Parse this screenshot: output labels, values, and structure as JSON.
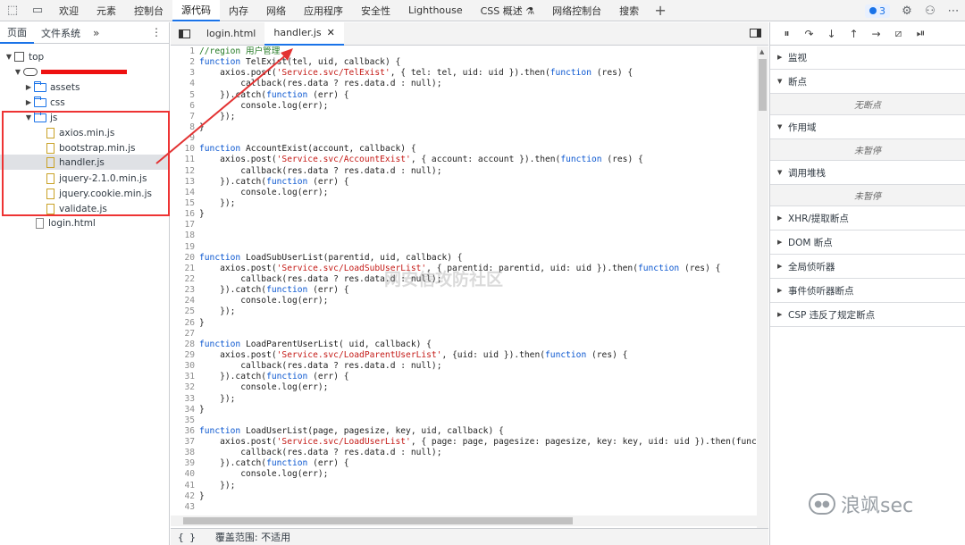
{
  "topbar": {
    "tabs": [
      "欢迎",
      "元素",
      "控制台",
      "源代码",
      "内存",
      "网络",
      "应用程序",
      "安全性",
      "Lighthouse",
      "CSS 概述 ⚗",
      "网络控制台",
      "搜索"
    ],
    "active_tab": "源代码",
    "badge_count": "3",
    "icons": [
      "inspect-icon",
      "device-icon",
      "plus-icon",
      "gear-icon",
      "connect-icon",
      "more-icon"
    ]
  },
  "navigator": {
    "tabs": [
      "页面",
      "文件系统"
    ],
    "tree": {
      "top": "top",
      "folders": [
        "assets",
        "css",
        "js"
      ],
      "js_files": [
        "axios.min.js",
        "bootstrap.min.js",
        "handler.js",
        "jquery-2.1.0.min.js",
        "jquery.cookie.min.js",
        "validate.js"
      ],
      "root_file": "login.html",
      "selected": "handler.js"
    }
  },
  "editor": {
    "tabs": [
      "login.html",
      "handler.js"
    ],
    "active_tab": "handler.js",
    "lines": [
      "//region 用户管理",
      "function TelExist(tel, uid, callback) {",
      "    axios.post('Service.svc/TelExist', { tel: tel, uid: uid }).then(function (res) {",
      "        callback(res.data ? res.data.d : null);",
      "    }).catch(function (err) {",
      "        console.log(err);",
      "    });",
      "}",
      "",
      "function AccountExist(account, callback) {",
      "    axios.post('Service.svc/AccountExist', { account: account }).then(function (res) {",
      "        callback(res.data ? res.data.d : null);",
      "    }).catch(function (err) {",
      "        console.log(err);",
      "    });",
      "}",
      "",
      "",
      "",
      "function LoadSubUserList(parentid, uid, callback) {",
      "    axios.post('Service.svc/LoadSubUserList', { parentid: parentid, uid: uid }).then(function (res) {",
      "        callback(res.data ? res.data.d : null);",
      "    }).catch(function (err) {",
      "        console.log(err);",
      "    });",
      "}",
      "",
      "function LoadParentUserList( uid, callback) {",
      "    axios.post('Service.svc/LoadParentUserList', {uid: uid }).then(function (res) {",
      "        callback(res.data ? res.data.d : null);",
      "    }).catch(function (err) {",
      "        console.log(err);",
      "    });",
      "}",
      "",
      "function LoadUserList(page, pagesize, key, uid, callback) {",
      "    axios.post('Service.svc/LoadUserList', { page: page, pagesize: pagesize, key: key, uid: uid }).then(functio",
      "        callback(res.data ? res.data.d : null);",
      "    }).catch(function (err) {",
      "        console.log(err);",
      "    });",
      "}",
      ""
    ],
    "status_brackets": "{ }",
    "status_text": "覆盖范围: 不适用"
  },
  "debugger": {
    "sections": [
      {
        "title": "监视",
        "expanded": false,
        "empty": ""
      },
      {
        "title": "断点",
        "expanded": true,
        "empty": "无断点"
      },
      {
        "title": "作用域",
        "expanded": true,
        "empty": "未暂停"
      },
      {
        "title": "调用堆栈",
        "expanded": true,
        "empty": "未暂停"
      },
      {
        "title": "XHR/提取断点",
        "expanded": false,
        "empty": ""
      },
      {
        "title": "DOM 断点",
        "expanded": false,
        "empty": ""
      },
      {
        "title": "全局侦听器",
        "expanded": false,
        "empty": ""
      },
      {
        "title": "事件侦听器断点",
        "expanded": false,
        "empty": ""
      },
      {
        "title": "CSP 违反了规定断点",
        "expanded": false,
        "empty": ""
      }
    ]
  },
  "watermark": {
    "center_text": "网安信攻防社区",
    "corner_text": "浪飒sec"
  },
  "colors": {
    "accent": "#1a73e8",
    "annotation": "#e33333",
    "string": "#c41a16",
    "keyword": "#0b57d0",
    "comment": "#237a23"
  }
}
